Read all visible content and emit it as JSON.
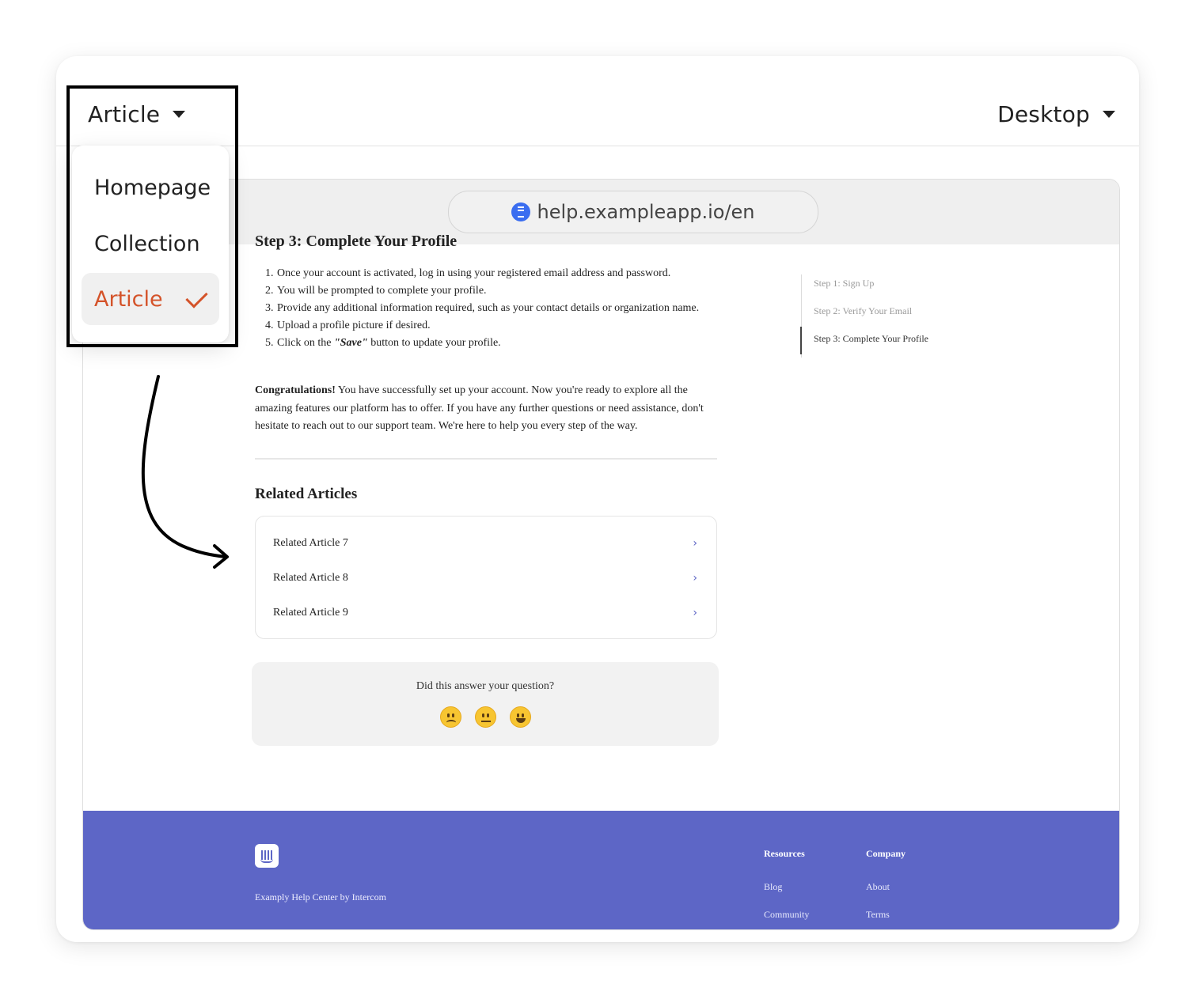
{
  "toolbar": {
    "page_type": "Article",
    "device": "Desktop"
  },
  "menu": {
    "items": [
      {
        "label": "Homepage",
        "selected": false
      },
      {
        "label": "Collection",
        "selected": false
      },
      {
        "label": "Article",
        "selected": true
      }
    ]
  },
  "browser": {
    "url": "help.exampleapp.io/en"
  },
  "article": {
    "cut_heading": "Step 3: Complete Your Profile",
    "steps": [
      {
        "num": "1.",
        "text": "Once your account is activated, log in using your registered email address and password."
      },
      {
        "num": "2.",
        "text": "You will be prompted to complete your profile."
      },
      {
        "num": "3.",
        "text": "Provide any additional information required, such as your contact details or organization name."
      },
      {
        "num": "4.",
        "text": "Upload a profile picture if desired."
      },
      {
        "num": "5.",
        "text_before": "Click on the ",
        "quoted": "\"Save\"",
        "text_after": " button to update your profile."
      }
    ],
    "congrats_bold": "Congratulations!",
    "congrats_text": " You have successfully set up your account. Now you're ready to explore all the amazing features our platform has to offer. If you have any further questions or need assistance, don't hesitate to reach out to our support team. We're here to help you every step of the way."
  },
  "related": {
    "title": "Related Articles",
    "items": [
      "Related Article 7",
      "Related Article 8",
      "Related Article 9"
    ]
  },
  "feedback": {
    "question": "Did this answer your question?"
  },
  "toc": {
    "items": [
      {
        "label": "Step 1: Sign Up",
        "active": false
      },
      {
        "label": "Step 2: Verify Your Email",
        "active": false
      },
      {
        "label": "Step 3: Complete Your Profile",
        "active": true
      }
    ]
  },
  "footer": {
    "name": "Examply Help Center by Intercom",
    "resources_heading": "Resources",
    "company_heading": "Company",
    "resources_links": [
      "Blog",
      "Community"
    ],
    "company_links": [
      "About",
      "Terms"
    ]
  },
  "colors": {
    "footer_bg": "#5d66c6",
    "accent": "#d4532a",
    "link_chevron": "#5b63c4"
  }
}
